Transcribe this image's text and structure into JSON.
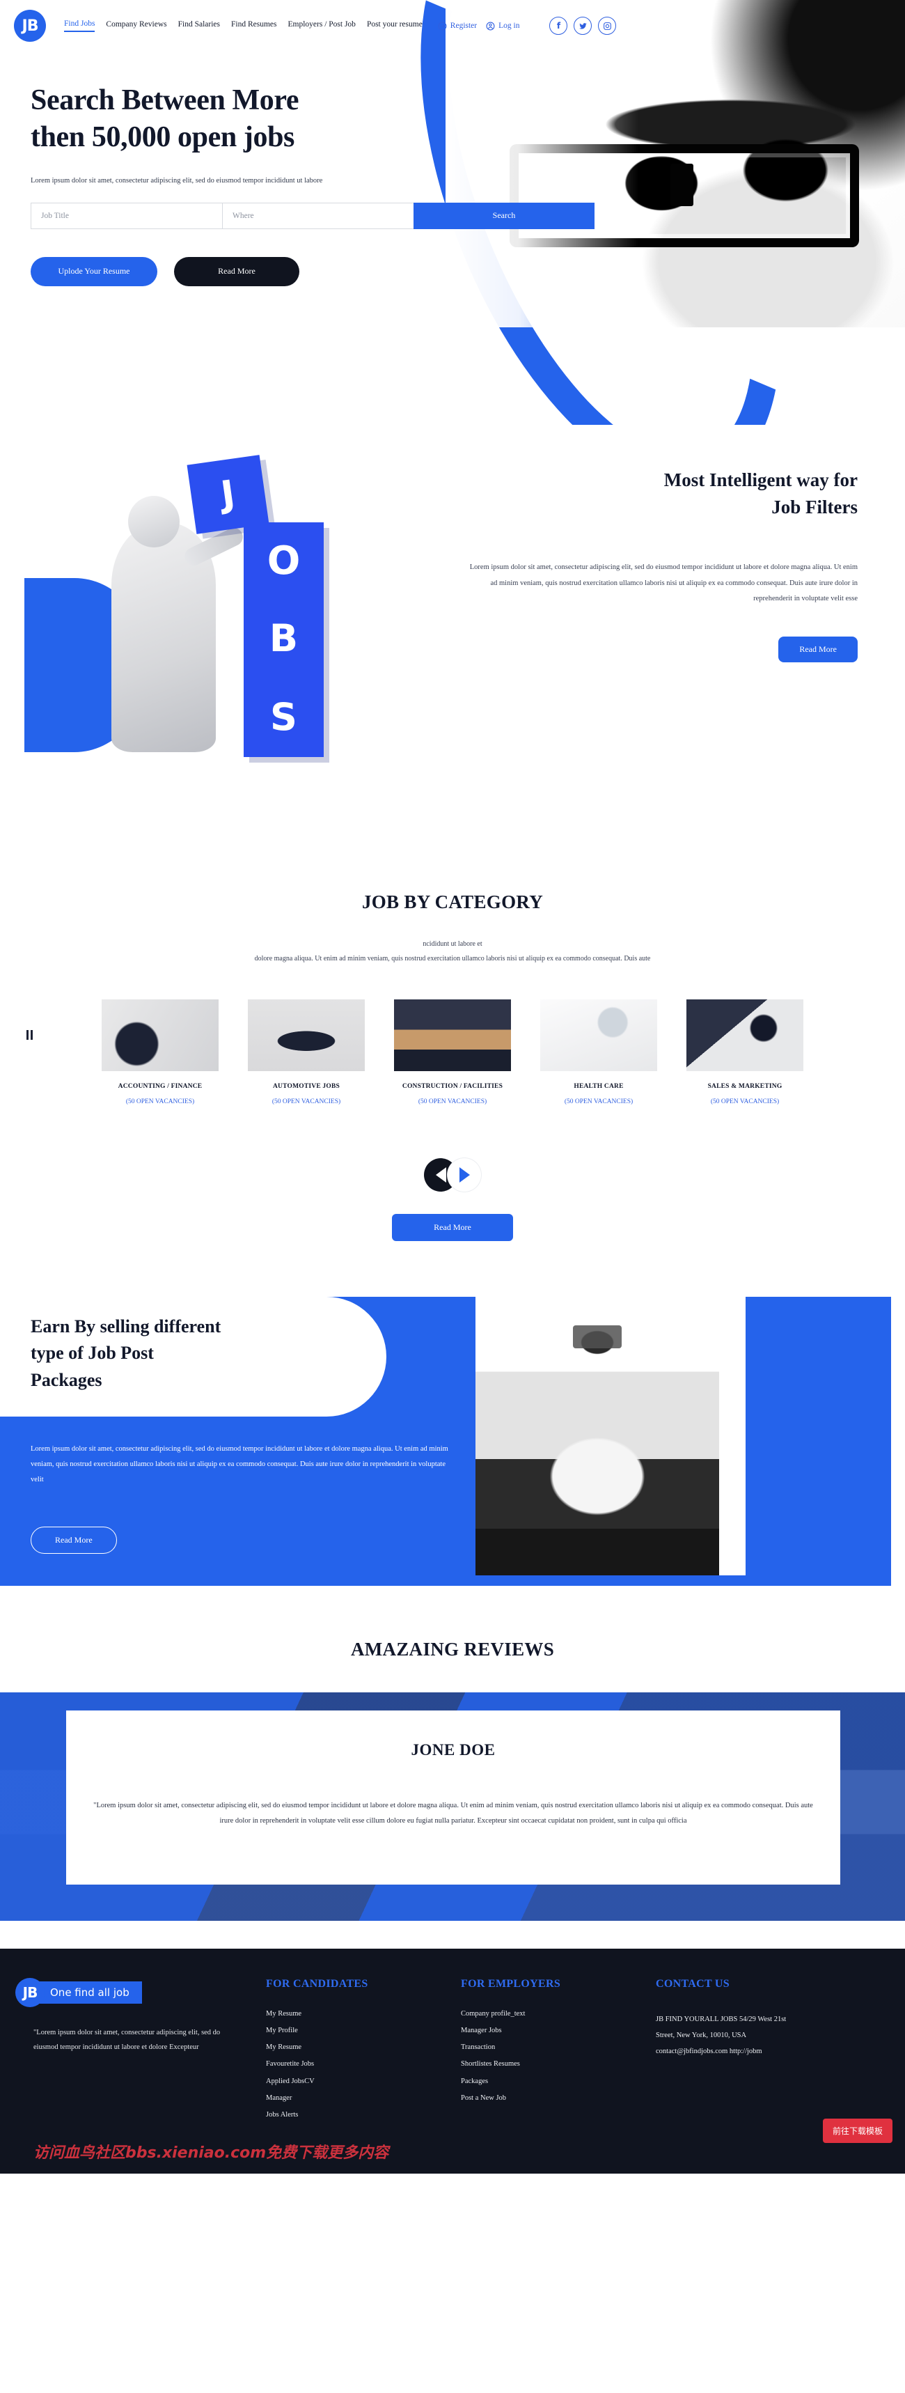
{
  "nav": {
    "logo": "JB",
    "links": [
      {
        "label": "Find Jobs",
        "active": true
      },
      {
        "label": "Company Reviews",
        "active": false
      },
      {
        "label": "Find Salaries",
        "active": false
      },
      {
        "label": "Find Resumes",
        "active": false
      },
      {
        "label": "Employers / Post Job",
        "active": false
      },
      {
        "label": "Post your resume",
        "active": false
      }
    ],
    "register": "Register",
    "login": "Log in",
    "socials": [
      "facebook-icon",
      "twitter-icon",
      "instagram-icon"
    ]
  },
  "hero": {
    "heading_line1": "Search Between More",
    "heading_line2": "then 50,000 open jobs",
    "subtext": "Lorem ipsum dolor sit amet, consectetur adipiscing elit, sed do eiusmod tempor incididunt ut labore",
    "job_title_placeholder": "Job Title",
    "where_placeholder": "Where",
    "job_title_value": "",
    "where_value": "",
    "search_button": "Search",
    "upload_button": "Uplode Your Resume",
    "read_more_button": "Read More"
  },
  "filters": {
    "heading_line1": "Most Intelligent way for",
    "heading_line2": "Job Filters",
    "paragraph": "Lorem ipsum dolor sit amet, consectetur adipiscing elit, sed do eiusmod tempor incididunt ut labore et dolore magna aliqua. Ut enim ad minim veniam, quis nostrud exercitation ullamco laboris nisi ut aliquip ex ea commodo consequat. Duis aute irure dolor in reprehenderit in voluptate velit esse",
    "read_more_button": "Read More",
    "cube_letters": [
      "J",
      "O",
      "B",
      "S"
    ]
  },
  "category": {
    "title": "JOB BY CATEGORY",
    "sub_line1": "ncididunt ut labore et",
    "sub_line2": "dolore magna aliqua. Ut enim ad minim veniam, quis nostrud exercitation ullamco laboris nisi ut aliquip ex ea commodo consequat. Duis aute",
    "items": [
      {
        "name": "ACCOUNTING / FINANCE",
        "vacancies": "(50 OPEN VACANCIES)"
      },
      {
        "name": "AUTOMOTIVE JOBS",
        "vacancies": "(50 OPEN VACANCIES)"
      },
      {
        "name": "CONSTRUCTION / FACILITIES",
        "vacancies": "(50 OPEN VACANCIES)"
      },
      {
        "name": "HEALTH CARE",
        "vacancies": "(50 OPEN VACANCIES)"
      },
      {
        "name": "SALES & MARKETING",
        "vacancies": "(50 OPEN VACANCIES)"
      }
    ],
    "read_more_button": "Read More"
  },
  "packages": {
    "heading_line1": "Earn By selling different",
    "heading_line2": "type of Job Post",
    "heading_line3": "Packages",
    "paragraph": "Lorem ipsum dolor sit amet, consectetur adipiscing elit, sed do eiusmod tempor incididunt ut labore et dolore magna aliqua. Ut enim ad minim veniam, quis nostrud exercitation ullamco laboris nisi ut aliquip ex ea commodo consequat. Duis aute irure dolor in reprehenderit in voluptate velit",
    "read_more_button": "Read More"
  },
  "reviews": {
    "title": "AMAZAING REVIEWS",
    "name": "JONE DOE",
    "text": "\"Lorem ipsum dolor sit amet, consectetur adipiscing elit, sed do eiusmod tempor incididunt ut labore et dolore magna aliqua. Ut enim ad minim veniam, quis nostrud exercitation ullamco laboris nisi ut aliquip ex ea commodo consequat. Duis aute irure dolor in reprehenderit in voluptate velit esse cillum dolore eu fugiat nulla pariatur. Excepteur sint occaecat cupidatat non proident, sunt in culpa qui officia"
  },
  "footer": {
    "logo": "JB",
    "tagline": "One find all job",
    "about": "\"Lorem ipsum dolor sit amet, consectetur adipiscing elit, sed do eiusmod tempor incididunt ut labore et dolore Excepteur",
    "candidates_heading": "FOR CANDIDATES",
    "candidates": [
      "My Resume",
      "My Profile",
      "My Resume",
      "Favouretite Jobs",
      "Applied JobsCV",
      "Manager",
      "Jobs Alerts"
    ],
    "employers_heading": "FOR EMPLOYERS",
    "employers": [
      "Company profile_text",
      "Manager Jobs",
      "Transaction",
      "Shortlistes Resumes",
      "Packages",
      "Post a New Job"
    ],
    "contact_heading": "CONTACT US",
    "address_line1": "JB FIND YOURALL JOBS 54/29 West 21st",
    "address_line2": "Street, New York, 10010, USA",
    "address_line3": "contact@jbfindjobs.com http://jobm"
  },
  "watermark": {
    "text": "访问血鸟社区bbs.xieniao.com免费下载更多内容",
    "download_button": "前往下载模板"
  },
  "colors": {
    "accent": "#2563eb",
    "dark": "#10141f",
    "link": "#2f5fe0",
    "watermark_red": "#d6333f"
  }
}
